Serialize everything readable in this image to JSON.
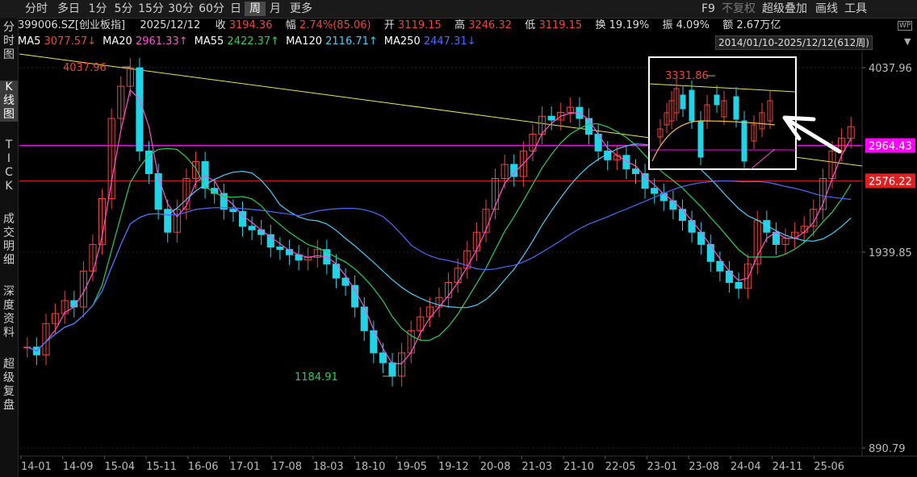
{
  "toolbar": {
    "periods": [
      "分时",
      "多日",
      "1分",
      "5分",
      "15分",
      "30分",
      "60分",
      "日",
      "周",
      "月",
      "更多"
    ],
    "active_period": "周",
    "right_items": [
      "F9",
      "不复权",
      "超级叠加",
      "画线",
      "工具"
    ]
  },
  "sidebar": {
    "items": [
      "分时图",
      "K线图",
      "TICK",
      "成交明细",
      "深度资料",
      "超级复盘"
    ],
    "active": "K线图"
  },
  "info": {
    "code": "399006.SZ[创业板指]",
    "date": "2025/12/12",
    "close_label": "收",
    "close": "3194.36",
    "change_label": "幅",
    "change": "2.74%(85.06)",
    "open_label": "开",
    "open": "3119.15",
    "high_label": "高",
    "high": "3246.32",
    "low_label": "低",
    "low": "3119.15",
    "turnover_label": "换",
    "turnover": "19.19%",
    "amplitude_label": "振",
    "amplitude": "4.09%",
    "amount_label": "额",
    "amount": "2.67万亿"
  },
  "ma": [
    {
      "name": "MA5",
      "value": "3077.57↓",
      "color": "#ffffff",
      "value_color": "#f0443b"
    },
    {
      "name": "MA20",
      "value": "2961.33↑",
      "color": "#ffffff",
      "value_color": "#ff4fd8"
    },
    {
      "name": "MA55",
      "value": "2422.37↑",
      "color": "#ffffff",
      "value_color": "#1fd15f"
    },
    {
      "name": "MA120",
      "value": "2116.71↑",
      "color": "#ffffff",
      "value_color": "#3fd0ff"
    },
    {
      "name": "MA250",
      "value": "2447.31↓",
      "color": "#ffffff",
      "value_color": "#4a6bff"
    }
  ],
  "date_range": "2014/01/10-2025/12/12(612周)",
  "chart_data": {
    "type": "candlestick",
    "x_ticks": [
      "14-01",
      "14-09",
      "15-04",
      "15-11",
      "16-06",
      "17-01",
      "17-08",
      "18-03",
      "18-10",
      "19-05",
      "19-12",
      "20-08",
      "21-03",
      "21-10",
      "22-05",
      "23-01",
      "23-08",
      "24-04",
      "24-11",
      "25-06"
    ],
    "y_ticks": [
      "4037.96",
      "1939.85",
      "890.79"
    ],
    "annotations": {
      "high": "4037.96",
      "low": "1184.91",
      "inset_high": "3331.86"
    },
    "price_lines": [
      {
        "value": "2964.43",
        "color": "#ff00ff"
      },
      {
        "value": "2576.22",
        "color": "#e02020"
      }
    ],
    "close_series": [
      1330,
      1290,
      1460,
      1520,
      1600,
      1560,
      1800,
      2000,
      2400,
      3300,
      3750,
      4037,
      2900,
      2650,
      2300,
      2100,
      2300,
      2600,
      2780,
      2500,
      2450,
      2300,
      2280,
      2150,
      2120,
      2080,
      1980,
      1960,
      1920,
      1880,
      1900,
      1960,
      1850,
      1750,
      1700,
      1560,
      1420,
      1300,
      1250,
      1185,
      1300,
      1420,
      1500,
      1560,
      1620,
      1720,
      1820,
      1950,
      2100,
      2300,
      2600,
      2750,
      2620,
      2900,
      3100,
      3330,
      3280,
      3380,
      3450,
      3300,
      3100,
      2900,
      2800,
      2850,
      2700,
      2650,
      2500,
      2450,
      2380,
      2300,
      2200,
      2100,
      2000,
      1870,
      1800,
      1720,
      1680,
      1850,
      2200,
      2100,
      2000,
      2050,
      2100,
      2150,
      2300,
      2600,
      2900,
      3050,
      3194
    ]
  },
  "legend_colors": {
    "up": "#f0443b",
    "down": "#22d3e6",
    "trendline": "#e8e84a",
    "ma5": "#ffffff",
    "ma20": "#ff4fd8",
    "ma55": "#1fd15f",
    "ma120": "#3fd0ff",
    "ma250": "#4a6bff"
  }
}
